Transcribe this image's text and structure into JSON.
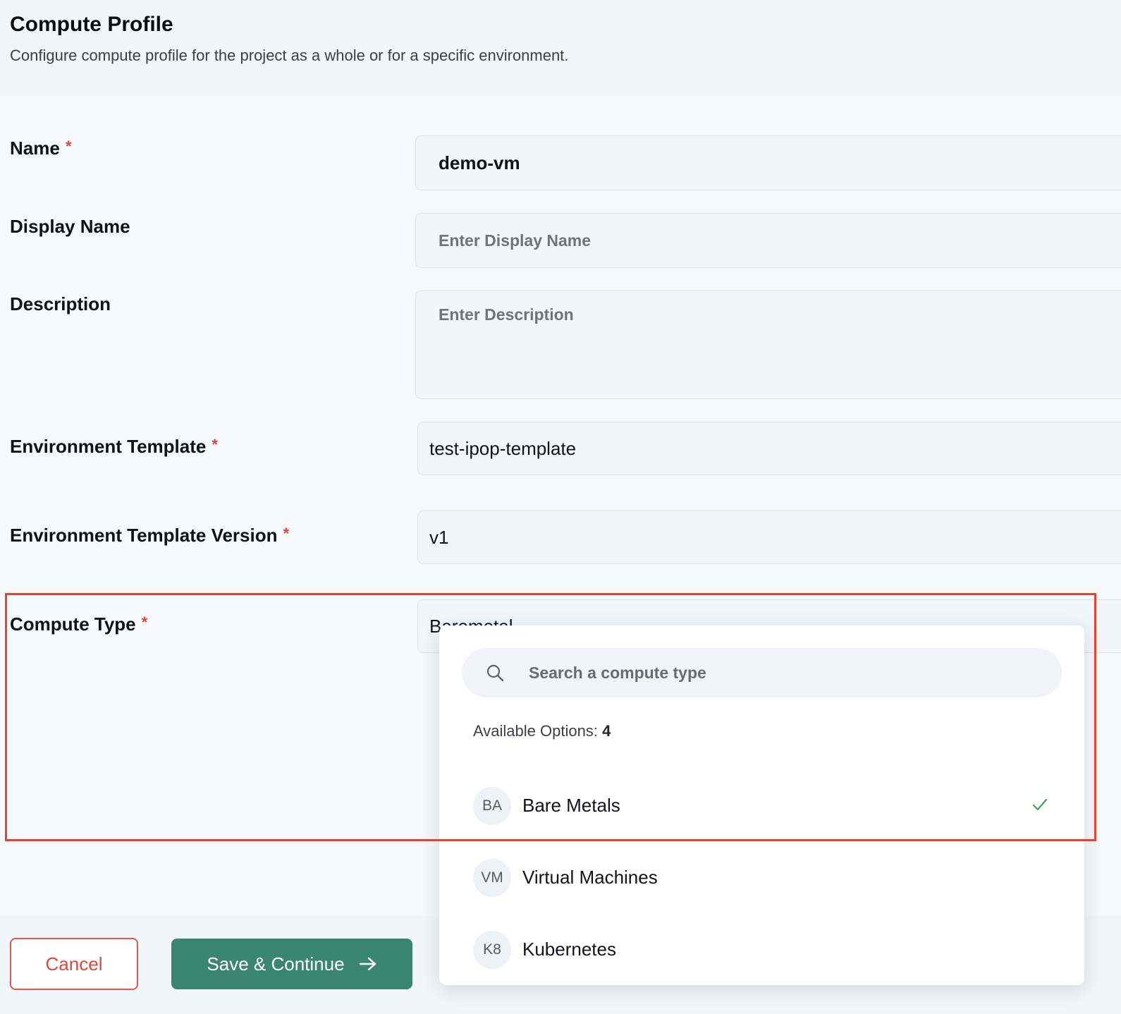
{
  "header": {
    "title": "Compute Profile",
    "subtitle": "Configure compute profile for the project as a whole or for a specific environment."
  },
  "form": {
    "required_marker": "*",
    "name": {
      "label": "Name",
      "value": "demo-vm"
    },
    "display_name": {
      "label": "Display Name",
      "placeholder": "Enter Display Name"
    },
    "description": {
      "label": "Description",
      "placeholder": "Enter Description"
    },
    "environment_template": {
      "label": "Environment Template",
      "value": "test-ipop-template"
    },
    "environment_template_version": {
      "label": "Environment Template Version",
      "value": "v1"
    },
    "compute_type": {
      "label": "Compute Type",
      "value": "Baremetal"
    }
  },
  "dropdown": {
    "search_placeholder": "Search a compute type",
    "available_label": "Available Options:",
    "available_count": "4",
    "options": [
      {
        "badge": "BA",
        "label": "Bare Metals",
        "selected": true
      },
      {
        "badge": "VM",
        "label": "Virtual Machines",
        "selected": false
      },
      {
        "badge": "K8",
        "label": "Kubernetes",
        "selected": false
      }
    ]
  },
  "footer": {
    "cancel_label": "Cancel",
    "save_label": "Save & Continue"
  },
  "colors": {
    "accent": "#3b8575",
    "required": "#e0453a",
    "highlight": "#e2442e",
    "check": "#3fa45b"
  },
  "icons": [
    "search-icon",
    "check-icon",
    "arrow-right-icon"
  ]
}
